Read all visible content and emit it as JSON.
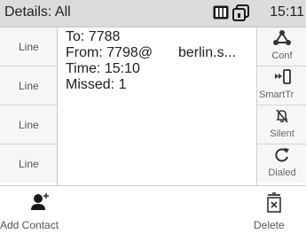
{
  "header": {
    "title": "Details: All",
    "time": "15:11",
    "status_icons": [
      "keypad-status-icon",
      "device-status-icon"
    ]
  },
  "line_keys": [
    {
      "label": "Line"
    },
    {
      "label": "Line"
    },
    {
      "label": "Line"
    },
    {
      "label": "Line"
    }
  ],
  "details": {
    "to": "To: 7788",
    "from_left": "From: 7798@",
    "from_right": "berlin.s...",
    "time": "Time: 15:10",
    "missed": "Missed: 1"
  },
  "soft_keys": [
    {
      "label": "Conf",
      "icon": "conference-icon"
    },
    {
      "label": "SmartTr",
      "icon": "smart-transfer-icon"
    },
    {
      "label": "Silent",
      "icon": "silent-bell-icon"
    },
    {
      "label": "Dialed",
      "icon": "redial-icon"
    }
  ],
  "bottom": {
    "add_contact": "Add Contact",
    "delete": "Delete"
  }
}
